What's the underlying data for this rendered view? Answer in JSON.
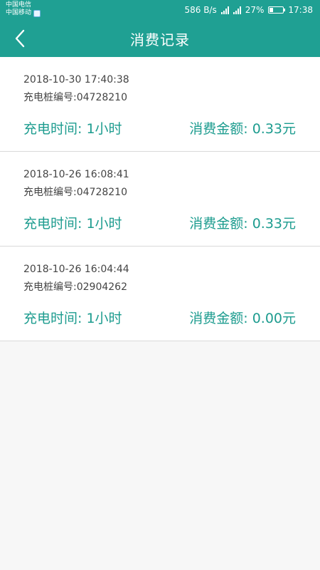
{
  "status_bar": {
    "carrier_1": "中国电信",
    "carrier_2": "中国移动",
    "net_speed": "586 B/s",
    "battery_percent": "27%",
    "battery_level": 0.27,
    "time": "17:38"
  },
  "header": {
    "title": "消费记录",
    "back_icon": "chevron-left-icon"
  },
  "records": [
    {
      "time": "2018-10-30 17:40:38",
      "pile": "充电桩编号:04728210",
      "duration": "充电时间: 1小时",
      "amount": "消费金额: 0.33元"
    },
    {
      "time": "2018-10-26 16:08:41",
      "pile": "充电桩编号:04728210",
      "duration": "充电时间: 1小时",
      "amount": "消费金额: 0.33元"
    },
    {
      "time": "2018-10-26 16:04:44",
      "pile": "充电桩编号:02904262",
      "duration": "充电时间: 1小时",
      "amount": "消费金额: 0.00元"
    }
  ],
  "colors": {
    "primary": "#1fa093",
    "accent_text": "#1d9c8f",
    "background": "#f7f7f7"
  }
}
